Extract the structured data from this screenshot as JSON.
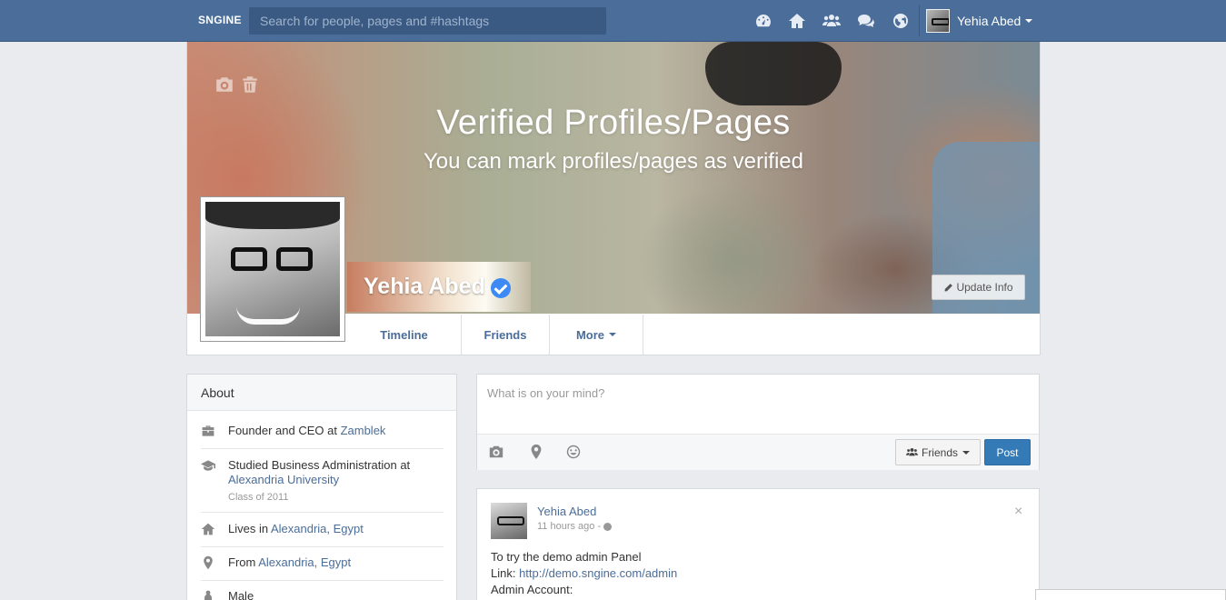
{
  "topbar": {
    "brand": "SNGINE",
    "search_placeholder": "Search for people, pages and #hashtags",
    "icons": [
      "dashboard-icon",
      "home-icon",
      "friends-icon",
      "messages-icon",
      "globe-icon"
    ],
    "user_name": "Yehia Abed"
  },
  "cover": {
    "title": "Verified Profiles/Pages",
    "subtitle": "You can mark profiles/pages as verified"
  },
  "profile": {
    "name": "Yehia Abed",
    "update_info_label": "Update Info",
    "tabs": [
      {
        "label": "Timeline"
      },
      {
        "label": "Friends"
      },
      {
        "label": "More"
      }
    ]
  },
  "about": {
    "title": "About",
    "work_prefix": "Founder and CEO at ",
    "work_link": "Zamblek",
    "study_prefix": "Studied Business Administration at",
    "study_link": "Alexandria University",
    "study_sub": "Class of 2011",
    "lives_prefix": "Lives in ",
    "lives_link": "Alexandria, Egypt",
    "from_prefix": "From ",
    "from_link": "Alexandria, Egypt",
    "gender": "Male"
  },
  "publisher": {
    "placeholder": "What is on your mind?",
    "privacy_label": "Friends",
    "post_label": "Post"
  },
  "post": {
    "author": "Yehia Abed",
    "time": "11 hours ago - ",
    "close_glyph": "×",
    "line1": "To try the demo admin Panel",
    "line2_prefix": "Link: ",
    "line2_link": "http://demo.sngine.com/admin",
    "line3": "Admin Account:"
  },
  "colors": {
    "topbar": "#4a6d99",
    "link": "#4a6d99",
    "post_button": "#337ab7",
    "verified_badge": "#3d8af7"
  }
}
